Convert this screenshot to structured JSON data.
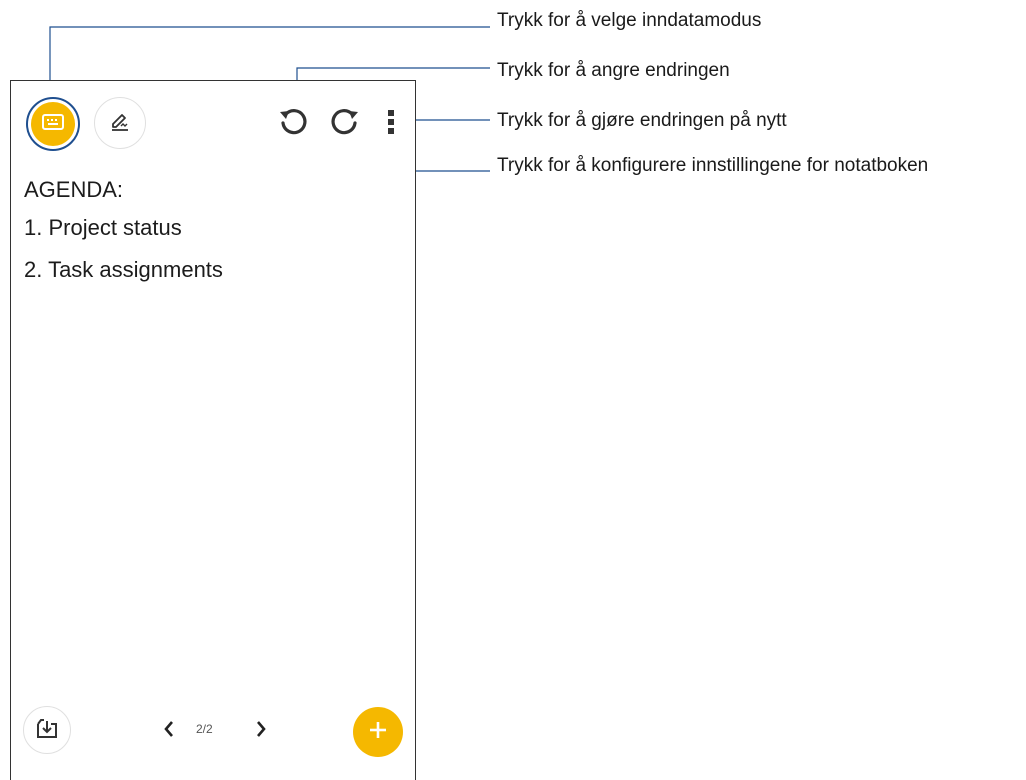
{
  "toolbar": {
    "input_mode_icon": "keyboard-icon",
    "pen_icon": "pen-signature-icon",
    "undo_icon": "undo-icon",
    "redo_icon": "redo-icon",
    "more_icon": "more-vert-icon"
  },
  "note": {
    "lines": [
      "AGENDA:",
      "1. Project status",
      "2. Task assignments"
    ]
  },
  "bottom_bar": {
    "import_icon": "import-icon",
    "prev_icon": "chevron-left-icon",
    "next_icon": "chevron-right-icon",
    "page_indicator": "2/2",
    "add_icon": "plus-icon"
  },
  "callouts": {
    "input_mode": "Trykk for å velge inndatamodus",
    "undo": "Trykk for å angre endringen",
    "redo": "Trykk for å gjøre endringen på nytt",
    "settings": "Trykk for å konfigurere innstillingene for notatboken"
  },
  "colors": {
    "accent": "#f5b800",
    "leader_line": "#1f4f8f",
    "frame": "#333333"
  }
}
